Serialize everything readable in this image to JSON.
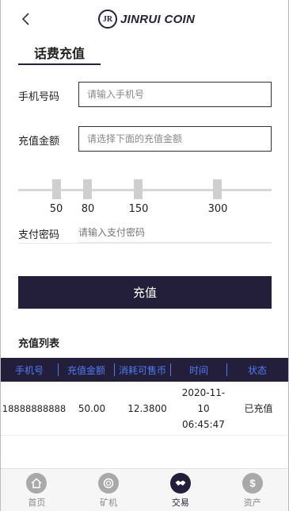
{
  "header": {
    "logo_mark": "JR",
    "brand": "JINRUI COIN"
  },
  "section_tab": "话费充值",
  "form": {
    "phone_label": "手机号码",
    "phone_placeholder": "请输入手机号",
    "amount_label": "充值金额",
    "amount_placeholder": "请选择下面的充值金额",
    "amount_options": [
      "50",
      "80",
      "150",
      "300"
    ],
    "password_label": "支付密码",
    "password_placeholder": "请输入支付密码",
    "submit_label": "充值"
  },
  "list": {
    "title": "充值列表",
    "columns": [
      "手机号",
      "充值金额",
      "消耗可售币",
      "时间",
      "状态"
    ],
    "rows": [
      {
        "phone": "18888888888",
        "amount": "50.00",
        "coins": "12.3800",
        "date": "2020-11-10",
        "time": "06:45:47",
        "status": "已充值"
      }
    ]
  },
  "tabbar": {
    "items": [
      {
        "label": "首页",
        "icon": "home-icon",
        "active": false
      },
      {
        "label": "矿机",
        "icon": "miner-icon",
        "active": false
      },
      {
        "label": "交易",
        "icon": "trade-icon",
        "active": true
      },
      {
        "label": "资产",
        "icon": "assets-icon",
        "active": false
      }
    ]
  },
  "colors": {
    "primary": "#231f3a",
    "header_text": "#4e7cf6"
  }
}
